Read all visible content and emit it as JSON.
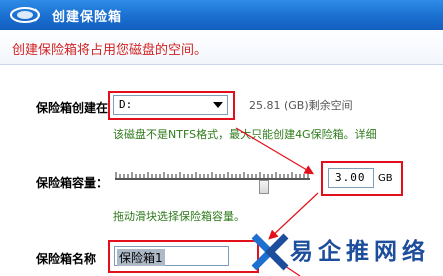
{
  "window": {
    "title": "创建保险箱"
  },
  "banner": {
    "text": "创建保险箱将占用您磁盘的空间。"
  },
  "location": {
    "label": "保险箱创建在",
    "selected_drive": "D:",
    "free_space": "25.81 (GB)剩余空间",
    "note": "该磁盘不是NTFS格式，最大只能创建4G保险箱。详细"
  },
  "capacity": {
    "label": "保险箱容量：",
    "value": "3.00",
    "unit": "GB",
    "hint": "拖动滑块选择保险箱容量。"
  },
  "name": {
    "label": "保险箱名称",
    "value": "保险箱1"
  },
  "watermark": {
    "text": "易企推网络"
  },
  "colors": {
    "titlebar": "#1a6fd0",
    "highlight_red": "#e3101c",
    "banner_text": "#d22323",
    "note_green": "#2d7a1a"
  }
}
